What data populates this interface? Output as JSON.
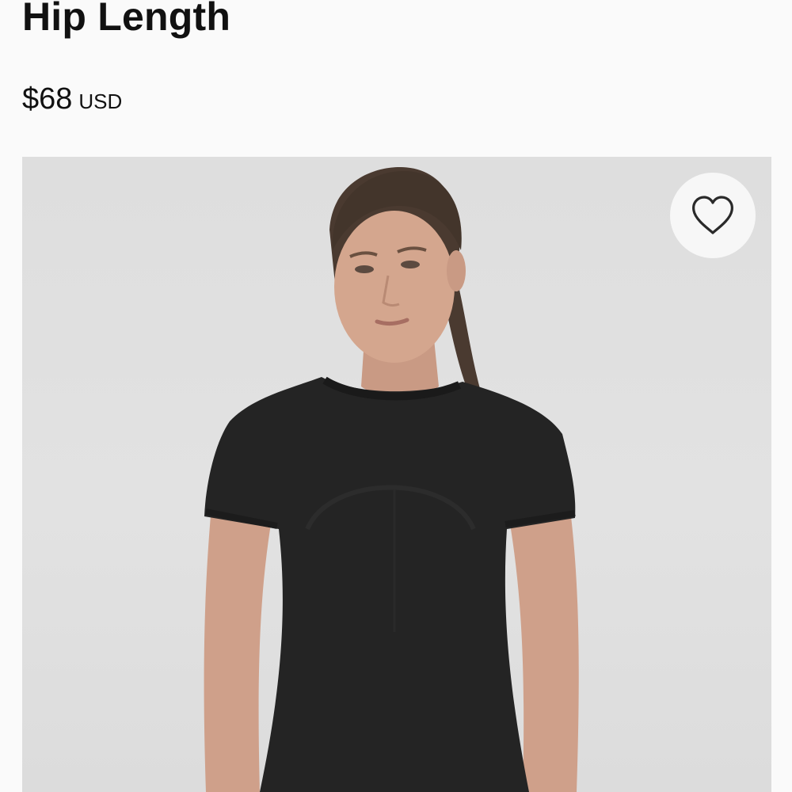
{
  "product": {
    "title": "Hip Length",
    "price": {
      "amount": "$68",
      "currency": "USD"
    }
  },
  "gallery": {
    "image_alt": "Model wearing black short-sleeve top",
    "wishlist_label": "Add to wishlist",
    "wishlist_icon": "heart-outline-icon"
  },
  "colors": {
    "background": "#fafafa",
    "text": "#111111",
    "image_background": "#e0e0e0",
    "garment": "#242424"
  }
}
